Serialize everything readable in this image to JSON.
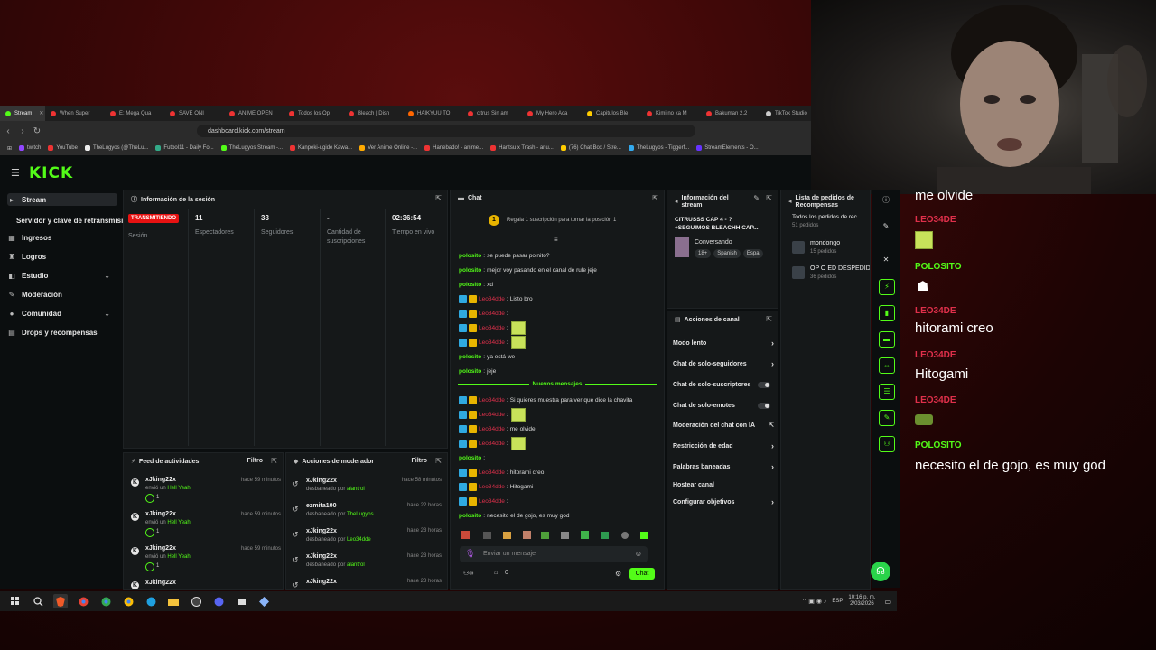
{
  "browser": {
    "tabs": [
      {
        "label": "Stream",
        "color": "#53fc18",
        "active": true
      },
      {
        "label": "When Super",
        "color": "#e33"
      },
      {
        "label": "E: Mega Qua",
        "color": "#e33"
      },
      {
        "label": "SAVE ONI",
        "color": "#e33"
      },
      {
        "label": "ANIME OPEN",
        "color": "#e33"
      },
      {
        "label": "Todos los Op",
        "color": "#e33"
      },
      {
        "label": "Bleach | Disn",
        "color": "#e33"
      },
      {
        "label": "HAIKYUU TO",
        "color": "#f60"
      },
      {
        "label": "citrus Sin am",
        "color": "#e33"
      },
      {
        "label": "My Hero Aca",
        "color": "#e33"
      },
      {
        "label": "Capitulos Ble",
        "color": "#fc0"
      },
      {
        "label": "Kimi no ka M",
        "color": "#e33"
      },
      {
        "label": "Bakuman 2.2",
        "color": "#e33"
      },
      {
        "label": "TikTok Studio",
        "color": "#ccc"
      }
    ],
    "url": "dashboard.kick.com/stream",
    "bookmarks": [
      {
        "label": "twitch",
        "color": "#9146ff"
      },
      {
        "label": "YouTube",
        "color": "#e33"
      },
      {
        "label": "TheLugyos (@TheLu...",
        "color": "#eee"
      },
      {
        "label": "Futbol11 - Daily Fo...",
        "color": "#3a8"
      },
      {
        "label": "TheLugyos Stream -...",
        "color": "#53fc18"
      },
      {
        "label": "Kanpeki-ugide Kawa...",
        "color": "#e33"
      },
      {
        "label": "Ver Anime Online -...",
        "color": "#fa0"
      },
      {
        "label": "Hanebado! - anime...",
        "color": "#e33"
      },
      {
        "label": "Hantsu x Trash - anu...",
        "color": "#e33"
      },
      {
        "label": "(76) Chat Box / Stre...",
        "color": "#fc0"
      },
      {
        "label": "TheLugyos - Tiggerf...",
        "color": "#3ae"
      },
      {
        "label": "StreamElements - O...",
        "color": "#63f"
      }
    ]
  },
  "kick": {
    "logo": "KICK",
    "nav": [
      {
        "label": "Stream",
        "icon": "broadcast-icon",
        "glyph": "▸",
        "active": true
      },
      {
        "label": "Servidor y clave de retransmisión",
        "icon": "",
        "glyph": ""
      },
      {
        "label": "Ingresos",
        "icon": "dollar-icon",
        "glyph": "▦"
      },
      {
        "label": "Logros",
        "icon": "trophy-icon",
        "glyph": "♜"
      },
      {
        "label": "Estudio",
        "icon": "studio-icon",
        "glyph": "◧",
        "chev": true
      },
      {
        "label": "Moderación",
        "icon": "wrench-icon",
        "glyph": "✎"
      },
      {
        "label": "Comunidad",
        "icon": "community-icon",
        "glyph": "●",
        "chev": true
      },
      {
        "label": "Drops y recompensas",
        "icon": "gift-icon",
        "glyph": "▤"
      }
    ],
    "session": {
      "title": "Información de la sesión",
      "status": "TRANSMITIENDO",
      "status_label": "Sesión",
      "stats": [
        {
          "value": "11",
          "label": "Espectadores"
        },
        {
          "value": "33",
          "label": "Seguidores"
        },
        {
          "value": "-",
          "label": "Cantidad de suscripciones"
        },
        {
          "value": "02:36:54",
          "label": "Tiempo en vivo"
        }
      ]
    },
    "feed": {
      "title": "Feed de actividades",
      "filter": "Filtro",
      "items": [
        {
          "user": "xJking22x",
          "action": "envió un",
          "item": "Hell Yeah",
          "time": "hace 59 minutos",
          "count": "1"
        },
        {
          "user": "xJking22x",
          "action": "envió un",
          "item": "Hell Yeah",
          "time": "hace 59 minutos",
          "count": "1"
        },
        {
          "user": "xJking22x",
          "action": "envió un",
          "item": "Hell Yeah",
          "time": "hace 59 minutos",
          "count": "1"
        },
        {
          "user": "xJking22x",
          "action": "",
          "item": "",
          "time": "",
          "count": ""
        }
      ]
    },
    "modactions": {
      "title": "Acciones de moderador",
      "filter": "Filtro",
      "items": [
        {
          "user": "xJking22x",
          "action": "desbaneado por",
          "by": "alantrol",
          "time": "hace 58 minutos"
        },
        {
          "user": "ezmita100",
          "action": "desbaneado por",
          "by": "TheLugyos",
          "time": "hace 22 horas"
        },
        {
          "user": "xJking22x",
          "action": "desbaneado por",
          "by": "Leo34dde",
          "time": "hace 23 horas"
        },
        {
          "user": "xJking22x",
          "action": "desbaneado por",
          "by": "alantrol",
          "time": "hace 23 horas"
        },
        {
          "user": "xJking22x",
          "action": "",
          "by": "",
          "time": "hace 23 horas"
        }
      ]
    },
    "chat": {
      "title": "Chat",
      "pinned": "Regala 1 suscripción para tomar la posición 1",
      "pinned_num": "1",
      "new_messages": "Nuevos mensajes",
      "messages": [
        {
          "nick": "polosito",
          "text": "se puede pasar poinito?",
          "badges": false,
          "emote": false
        },
        {
          "nick": "polosito",
          "text": "mejor voy pasando en el canal de rule jeje",
          "badges": false,
          "emote": false
        },
        {
          "nick": "polosito",
          "text": "xd",
          "badges": false,
          "emote": false
        },
        {
          "nick": "Leo34dde",
          "text": "Listo bro",
          "badges": true,
          "emote": false
        },
        {
          "nick": "Leo34dde",
          "text": "",
          "badges": true,
          "emote": false
        },
        {
          "nick": "Leo34dde",
          "text": "",
          "badges": true,
          "emote": true
        },
        {
          "nick": "Leo34dde",
          "text": "",
          "badges": true,
          "emote": true
        },
        {
          "nick": "polosito",
          "text": "ya está we",
          "badges": false,
          "emote": false
        },
        {
          "nick": "polosito",
          "text": "jeje",
          "badges": false,
          "emote": false
        },
        {
          "nick": "Leo34dde",
          "text": "Si quieres muestra para ver que dice la chavita",
          "badges": true,
          "emote": false
        },
        {
          "nick": "Leo34dde",
          "text": "",
          "badges": true,
          "emote": true
        },
        {
          "nick": "Leo34dde",
          "text": "me olvide",
          "badges": true,
          "emote": false
        },
        {
          "nick": "Leo34dde",
          "text": "",
          "badges": true,
          "emote": true
        },
        {
          "nick": "polosito",
          "text": "",
          "badges": false,
          "emote": false
        },
        {
          "nick": "Leo34dde",
          "text": "hitorami creo",
          "badges": true,
          "emote": false
        },
        {
          "nick": "Leo34dde",
          "text": "Hitogami",
          "badges": true,
          "emote": false
        },
        {
          "nick": "Leo34dde",
          "text": "",
          "badges": true,
          "emote": false
        },
        {
          "nick": "polosito",
          "text": "necesito el de gojo, es muy god",
          "badges": false,
          "emote": false
        }
      ],
      "input_placeholder": "Enviar un mensaje",
      "send_label": "Chat",
      "viewers_count": "0",
      "points": "0"
    },
    "streaminfo": {
      "title": "Información del stream",
      "stream_title": "CITRUSSS CAP 4 - ?\n+SEGUIMOS BLEACHH CAP...",
      "category": "Conversando",
      "tags": [
        "18+",
        "Spanish",
        "Espa"
      ]
    },
    "rewards": {
      "title": "Lista de pedidos de Recompensas",
      "all_label": "Todos los pedidos de rec",
      "all_count": "51 pedidos",
      "items": [
        {
          "name": "mondongo",
          "count": "15 pedidos"
        },
        {
          "name": "OP O ED DESPEDID",
          "count": "36 pedidos"
        }
      ]
    },
    "channel_actions": {
      "title": "Acciones de canal",
      "rows": [
        {
          "label": "Modo lento",
          "type": "chev"
        },
        {
          "label": "Chat de solo-seguidores",
          "type": "chev"
        },
        {
          "label": "Chat de solo-suscriptores",
          "type": "toggle"
        },
        {
          "label": "Chat de solo-emotes",
          "type": "toggle"
        },
        {
          "label": "Moderación del chat con IA",
          "type": "ext"
        },
        {
          "label": "Restricción de edad",
          "type": "chev"
        },
        {
          "label": "Palabras baneadas",
          "type": "chev"
        },
        {
          "label": "Hostear canal",
          "type": "none"
        },
        {
          "label": "Configurar objetivos",
          "type": "chev"
        }
      ]
    }
  },
  "overlay": {
    "messages": [
      {
        "name": "",
        "text": "me olvide",
        "emote": false
      },
      {
        "name": "LEO34DE",
        "text": "",
        "emote": true
      },
      {
        "name": "POLOSITO",
        "text": "",
        "emote": "ghost"
      },
      {
        "name": "LEO34DE",
        "text": "hitorami creo",
        "emote": false
      },
      {
        "name": "LEO34DE",
        "text": "Hitogami",
        "emote": false
      },
      {
        "name": "LEO34DE",
        "text": "",
        "emote": "small"
      },
      {
        "name": "POLOSITO",
        "text": "necesito el de gojo, es muy god",
        "emote": false
      }
    ],
    "name_colors": {
      "LEO34DE": "#e0304b",
      "POLOSITO": "#53fc18"
    }
  },
  "taskbar": {
    "time": "10:16 p. m.",
    "date": "2/03/2026",
    "lang": "ESP"
  }
}
